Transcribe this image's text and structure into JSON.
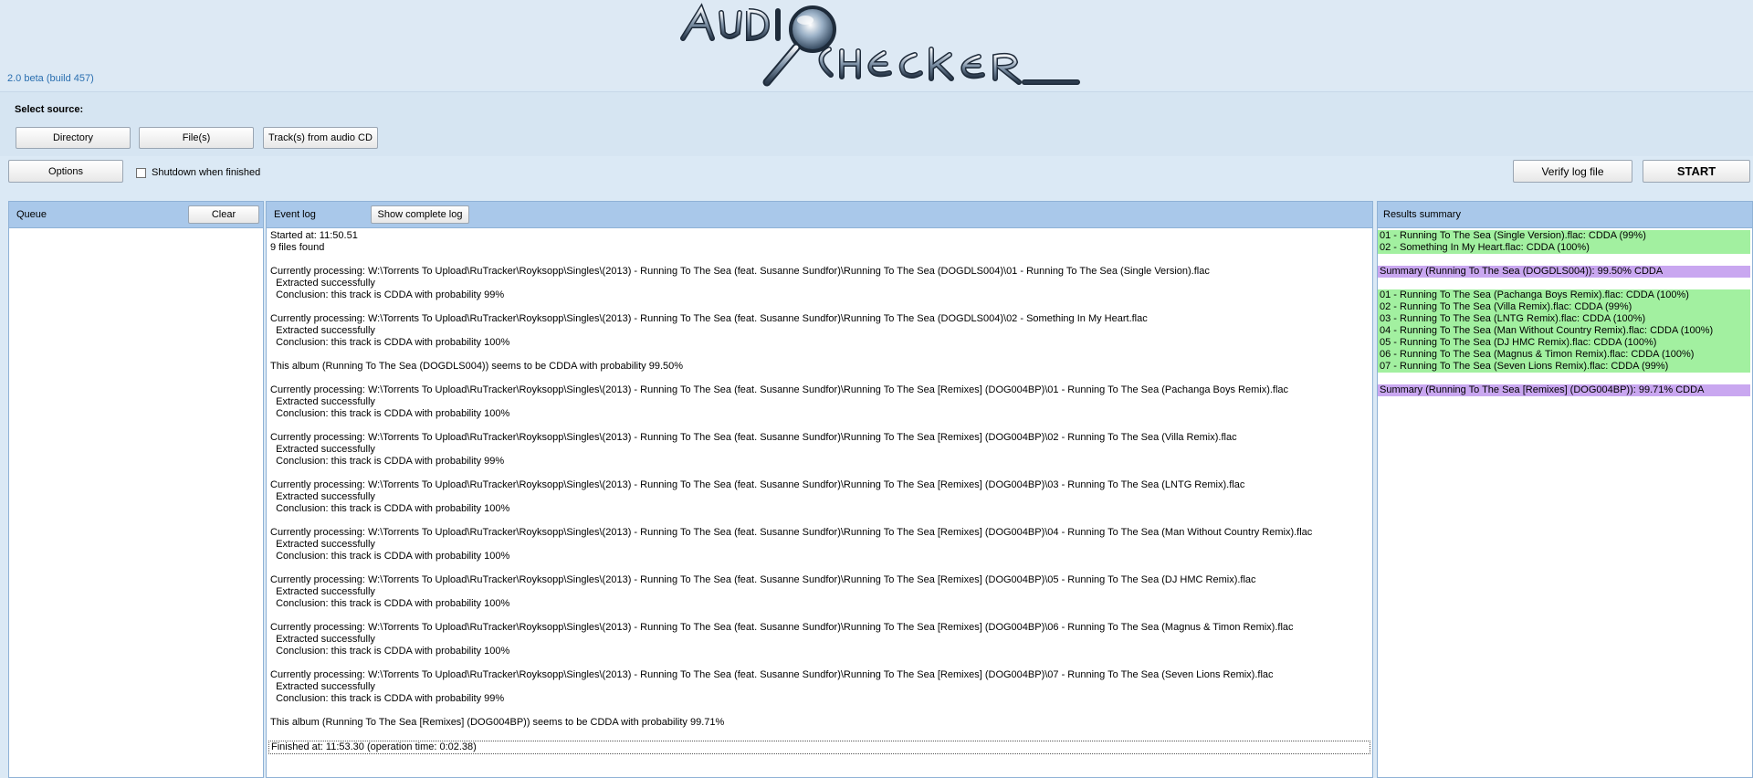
{
  "app": {
    "version": "2.0 beta (build 457)",
    "logo_text": "AUDIO CHECKER"
  },
  "source": {
    "label": "Select source:",
    "directory_button": "Directory",
    "files_button": "File(s)",
    "cd_button": "Track(s) from audio CD"
  },
  "controls": {
    "options_button": "Options",
    "shutdown_label": "Shutdown when finished",
    "shutdown_checked": false,
    "verify_button": "Verify log file",
    "start_button": "START"
  },
  "queue": {
    "title": "Queue",
    "clear_button": "Clear"
  },
  "event_log": {
    "title": "Event log",
    "show_complete_button": "Show complete log",
    "lines": [
      "Started at: 11:50.51",
      "9 files found",
      "",
      "Currently processing: W:\\Torrents To Upload\\RuTracker\\Royksopp\\Singles\\(2013) - Running To The Sea (feat. Susanne Sundfor)\\Running To The Sea (DOGDLS004)\\01 - Running To The Sea (Single Version).flac",
      "  Extracted successfully",
      "  Conclusion: this track is CDDA with probability 99%",
      "",
      "Currently processing: W:\\Torrents To Upload\\RuTracker\\Royksopp\\Singles\\(2013) - Running To The Sea (feat. Susanne Sundfor)\\Running To The Sea (DOGDLS004)\\02 - Something In My Heart.flac",
      "  Extracted successfully",
      "  Conclusion: this track is CDDA with probability 100%",
      "",
      "This album (Running To The Sea (DOGDLS004)) seems to be CDDA with probability 99.50%",
      "",
      "Currently processing: W:\\Torrents To Upload\\RuTracker\\Royksopp\\Singles\\(2013) - Running To The Sea (feat. Susanne Sundfor)\\Running To The Sea [Remixes] (DOG004BP)\\01 - Running To The Sea (Pachanga Boys Remix).flac",
      "  Extracted successfully",
      "  Conclusion: this track is CDDA with probability 100%",
      "",
      "Currently processing: W:\\Torrents To Upload\\RuTracker\\Royksopp\\Singles\\(2013) - Running To The Sea (feat. Susanne Sundfor)\\Running To The Sea [Remixes] (DOG004BP)\\02 - Running To The Sea (Villa Remix).flac",
      "  Extracted successfully",
      "  Conclusion: this track is CDDA with probability 99%",
      "",
      "Currently processing: W:\\Torrents To Upload\\RuTracker\\Royksopp\\Singles\\(2013) - Running To The Sea (feat. Susanne Sundfor)\\Running To The Sea [Remixes] (DOG004BP)\\03 - Running To The Sea (LNTG Remix).flac",
      "  Extracted successfully",
      "  Conclusion: this track is CDDA with probability 100%",
      "",
      "Currently processing: W:\\Torrents To Upload\\RuTracker\\Royksopp\\Singles\\(2013) - Running To The Sea (feat. Susanne Sundfor)\\Running To The Sea [Remixes] (DOG004BP)\\04 - Running To The Sea (Man Without Country Remix).flac",
      "  Extracted successfully",
      "  Conclusion: this track is CDDA with probability 100%",
      "",
      "Currently processing: W:\\Torrents To Upload\\RuTracker\\Royksopp\\Singles\\(2013) - Running To The Sea (feat. Susanne Sundfor)\\Running To The Sea [Remixes] (DOG004BP)\\05 - Running To The Sea (DJ HMC Remix).flac",
      "  Extracted successfully",
      "  Conclusion: this track is CDDA with probability 100%",
      "",
      "Currently processing: W:\\Torrents To Upload\\RuTracker\\Royksopp\\Singles\\(2013) - Running To The Sea (feat. Susanne Sundfor)\\Running To The Sea [Remixes] (DOG004BP)\\06 - Running To The Sea (Magnus & Timon Remix).flac",
      "  Extracted successfully",
      "  Conclusion: this track is CDDA with probability 100%",
      "",
      "Currently processing: W:\\Torrents To Upload\\RuTracker\\Royksopp\\Singles\\(2013) - Running To The Sea (feat. Susanne Sundfor)\\Running To The Sea [Remixes] (DOG004BP)\\07 - Running To The Sea (Seven Lions Remix).flac",
      "  Extracted successfully",
      "  Conclusion: this track is CDDA with probability 99%",
      "",
      "This album (Running To The Sea [Remixes] (DOG004BP)) seems to be CDDA with probability 99.71%",
      "",
      "Finished at: 11:53.30 (operation time: 0:02.38)"
    ]
  },
  "results": {
    "title": "Results summary",
    "lines": [
      {
        "text": "01 - Running To The Sea (Single Version).flac: CDDA (99%)",
        "kind": "green"
      },
      {
        "text": "02 - Something In My Heart.flac: CDDA (100%)",
        "kind": "green"
      },
      {
        "text": "",
        "kind": "blank"
      },
      {
        "text": "Summary (Running To The Sea (DOGDLS004)): 99.50% CDDA",
        "kind": "purple"
      },
      {
        "text": "",
        "kind": "blank"
      },
      {
        "text": "01 - Running To The Sea (Pachanga Boys Remix).flac: CDDA (100%)",
        "kind": "green"
      },
      {
        "text": "02 - Running To The Sea (Villa Remix).flac: CDDA (99%)",
        "kind": "green"
      },
      {
        "text": "03 - Running To The Sea (LNTG Remix).flac: CDDA (100%)",
        "kind": "green"
      },
      {
        "text": "04 - Running To The Sea (Man Without Country Remix).flac: CDDA (100%)",
        "kind": "green"
      },
      {
        "text": "05 - Running To The Sea (DJ HMC Remix).flac: CDDA (100%)",
        "kind": "green"
      },
      {
        "text": "06 - Running To The Sea (Magnus & Timon Remix).flac: CDDA (100%)",
        "kind": "green"
      },
      {
        "text": "07 - Running To The Sea (Seven Lions Remix).flac: CDDA (99%)",
        "kind": "green"
      },
      {
        "text": "",
        "kind": "blank"
      },
      {
        "text": "Summary (Running To The Sea [Remixes] (DOG004BP)): 99.71% CDDA",
        "kind": "purple"
      }
    ]
  },
  "colors": {
    "header_bg": "#dde9f4",
    "panel_header_bg": "#a9c8ea",
    "result_green": "#a2f0a0",
    "result_purple": "#c9a7f0",
    "version_text": "#2a6fb0"
  }
}
